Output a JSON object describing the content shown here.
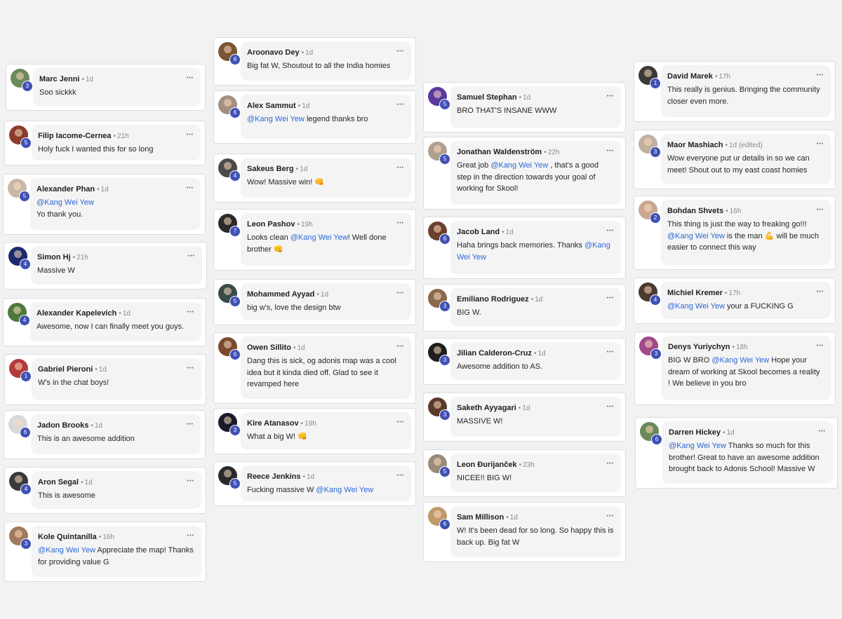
{
  "theme": {
    "mention_color": "#2b67d6",
    "level_badge_color": "#3f51b5",
    "bubble_color": "#f4f4f4"
  },
  "menu_icon": "more-horizontal-icon",
  "columns": [
    {
      "comments": [
        {
          "name": "Marc Jenni",
          "time": "1d",
          "level": "3",
          "avatar_color": "#6c8a5a",
          "parts": [
            {
              "t": "Soo sickkk"
            }
          ]
        },
        {
          "name": "Filip Iacome-Cernea",
          "time": "21h",
          "level": "5",
          "avatar_color": "#8a3b2c",
          "parts": [
            {
              "t": "Holy fuck I wanted this for so long"
            }
          ]
        },
        {
          "name": "Alexander Phan",
          "time": "1d",
          "level": "5",
          "avatar_color": "#c9b8a8",
          "parts": [
            {
              "t": "@Kang Wei Yew",
              "m": true
            },
            {
              "t": "Yo thank you.",
              "br": true
            }
          ]
        },
        {
          "name": "Simon Hj",
          "time": "21h",
          "level": "4",
          "avatar_color": "#1d2b6e",
          "parts": [
            {
              "t": "Massive W"
            }
          ]
        },
        {
          "name": "Alexander Kapelevich",
          "time": "1d",
          "level": "4",
          "avatar_color": "#4d7a3a",
          "parts": [
            {
              "t": "Awesome, now I can finally meet you guys."
            }
          ]
        },
        {
          "name": "Gabriel Pieroni",
          "time": "1d",
          "level": "1",
          "avatar_color": "#b33a3a",
          "parts": [
            {
              "t": "W's in the chat boys!"
            }
          ]
        },
        {
          "name": "Jadon Brooks",
          "time": "1d",
          "level": "6",
          "avatar_color": "#d9d9d9",
          "parts": [
            {
              "t": "This is an awesome addition"
            }
          ]
        },
        {
          "name": "Aron Segal",
          "time": "1d",
          "level": "4",
          "avatar_color": "#3a3a3a",
          "parts": [
            {
              "t": "This is awesome"
            }
          ]
        },
        {
          "name": "Kole Quintanilla",
          "time": "16h",
          "level": "3",
          "avatar_color": "#a07a5a",
          "parts": [
            {
              "t": "@Kang Wei Yew",
              "m": true
            },
            {
              "t": " Appreciate the map! Thanks for providing value G"
            }
          ]
        }
      ]
    },
    {
      "comments": [
        {
          "name": "Aroonavo Dey",
          "time": "1d",
          "level": "6",
          "avatar_color": "#7a5535",
          "parts": [
            {
              "t": "Big fat W, Shoutout to all the India homies"
            }
          ]
        },
        {
          "name": "Alex Sammut",
          "time": "1d",
          "level": "6",
          "avatar_color": "#a39080",
          "parts": [
            {
              "t": "@Kang Wei Yew",
              "m": true
            },
            {
              "t": " legend thanks bro"
            }
          ]
        },
        {
          "name": "Sakeus Berg",
          "time": "1d",
          "level": "4",
          "avatar_color": "#4a4a4a",
          "parts": [
            {
              "t": "Wow! Massive win! "
            },
            {
              "t": "👊",
              "e": true
            }
          ]
        },
        {
          "name": "Leon Pashov",
          "time": "19h",
          "level": "7",
          "avatar_color": "#2a2a2a",
          "parts": [
            {
              "t": "Looks clean "
            },
            {
              "t": "@Kang Wei Yew",
              "m": true
            },
            {
              "t": "! Well done brother "
            },
            {
              "t": "👊",
              "e": true
            }
          ]
        },
        {
          "name": "Mohammed Ayyad",
          "time": "1d",
          "level": "5",
          "avatar_color": "#3a4a4a",
          "parts": [
            {
              "t": "big w's, love the design btw"
            }
          ]
        },
        {
          "name": "Owen Sillito",
          "time": "1d",
          "level": "6",
          "avatar_color": "#7a4a30",
          "parts": [
            {
              "t": "Dang this is sick, og adonis map was a cool idea but it kinda died off. Glad to see it revamped here"
            }
          ]
        },
        {
          "name": "Kire Atanasov",
          "time": "19h",
          "level": "3",
          "avatar_color": "#1a1a2a",
          "parts": [
            {
              "t": "What a big W! "
            },
            {
              "t": "👊",
              "e": true
            }
          ]
        },
        {
          "name": "Reece Jenkins",
          "time": "1d",
          "level": "5",
          "avatar_color": "#2a2a2a",
          "parts": [
            {
              "t": "Fucking massive W "
            },
            {
              "t": "@Kang Wei Yew",
              "m": true
            }
          ]
        }
      ]
    },
    {
      "comments": [
        {
          "name": "Samuel Stephan",
          "time": "1d",
          "level": "5",
          "avatar_color": "#5a3aa0",
          "parts": [
            {
              "t": "BRO THAT'S INSANE WWW"
            }
          ]
        },
        {
          "name": "Jonathan Waldenström",
          "time": "22h",
          "level": "5",
          "avatar_color": "#b0a090",
          "parts": [
            {
              "t": "Great job "
            },
            {
              "t": "@Kang Wei Yew",
              "m": true
            },
            {
              "t": " , that's a good step in the direction towards your goal of working for Skool!"
            }
          ]
        },
        {
          "name": "Jacob Land",
          "time": "1d",
          "level": "6",
          "avatar_color": "#6a4030",
          "parts": [
            {
              "t": "Haha brings back memories. Thanks "
            },
            {
              "t": "@Kang Wei Yew",
              "m": true
            }
          ]
        },
        {
          "name": "Emiliano Rodriguez",
          "time": "1d",
          "level": "3",
          "avatar_color": "#8a6a4a",
          "parts": [
            {
              "t": "BIG W."
            }
          ]
        },
        {
          "name": "Jilian Calderon-Cruz",
          "time": "1d",
          "level": "3",
          "avatar_color": "#1f1f1f",
          "parts": [
            {
              "t": "Awesome addition to AS."
            }
          ]
        },
        {
          "name": "Saketh Ayyagari",
          "time": "1d",
          "level": "3",
          "avatar_color": "#5a3a2a",
          "parts": [
            {
              "t": "MASSIVE W!"
            }
          ]
        },
        {
          "name": "Leon Đurijanček",
          "time": "23h",
          "level": "5",
          "avatar_color": "#9a8a7a",
          "parts": [
            {
              "t": "NICEE!! BIG W!"
            }
          ]
        },
        {
          "name": "Sam Millison",
          "time": "1d",
          "level": "6",
          "avatar_color": "#c09a6a",
          "parts": [
            {
              "t": "W! It's been dead for so long. So happy this is back up. Big fat W"
            }
          ]
        }
      ]
    },
    {
      "comments": [
        {
          "name": "David Marek",
          "time": "17h",
          "level": "1",
          "avatar_color": "#3a3a3a",
          "parts": [
            {
              "t": "This really is genius. Bringing the community closer even more."
            }
          ]
        },
        {
          "name": "Maor Mashiach",
          "time": "1d",
          "edited": "(edited)",
          "level": "3",
          "avatar_color": "#c0b0a0",
          "parts": [
            {
              "t": "Wow everyone put ur details in so we can meet! Shout out to my east coast homies"
            }
          ]
        },
        {
          "name": "Bohdan Shvets",
          "time": "16h",
          "level": "2",
          "avatar_color": "#c8a890",
          "parts": [
            {
              "t": "This thing is just the way to freaking go!!! "
            },
            {
              "t": "@Kang Wei Yew",
              "m": true
            },
            {
              "t": " is the man "
            },
            {
              "t": "💪",
              "e": true
            },
            {
              "t": " will be much easier to connect this way"
            }
          ]
        },
        {
          "name": "Michiel Kremer",
          "time": "17h",
          "level": "4",
          "avatar_color": "#4a3a30",
          "parts": [
            {
              "t": "@Kang Wei Yew",
              "m": true
            },
            {
              "t": " your a FUCKING G"
            }
          ]
        },
        {
          "name": "Denys Yuriychyn",
          "time": "18h",
          "level": "3",
          "avatar_color": "#a04a8a",
          "parts": [
            {
              "t": "BIG W BRO "
            },
            {
              "t": "@Kang Wei Yew",
              "m": true
            },
            {
              "t": " Hope your dream of working at Skool becomes a reality ! We believe in you bro"
            }
          ]
        },
        {
          "name": "Darren Hickey",
          "time": "1d",
          "level": "6",
          "avatar_color": "#6a8a5a",
          "parts": [
            {
              "t": "@Kang Wei Yew",
              "m": true
            },
            {
              "t": " Thanks so much for this brother! Great to have an awesome addition brought back to Adonis School! Massive W"
            }
          ]
        }
      ]
    }
  ]
}
